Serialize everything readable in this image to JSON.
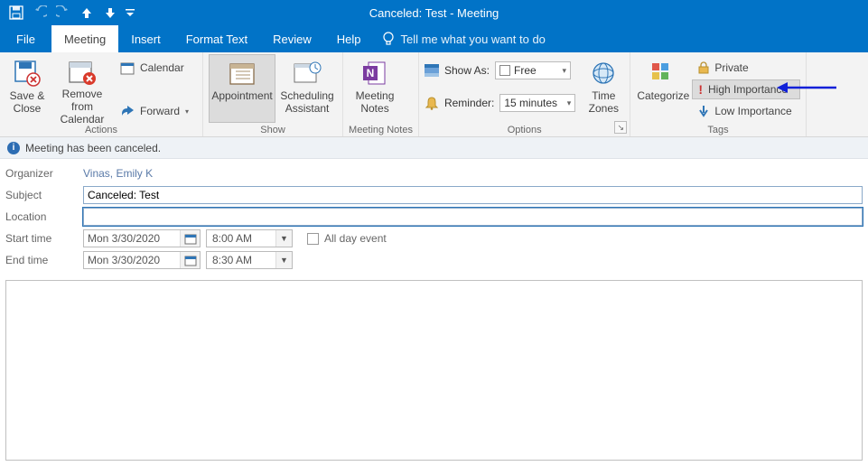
{
  "window": {
    "title": "Canceled: Test  -  Meeting"
  },
  "tabs": {
    "file": "File",
    "meeting": "Meeting",
    "insert": "Insert",
    "format": "Format Text",
    "review": "Review",
    "help": "Help",
    "tellme": "Tell me what you want to do"
  },
  "ribbon": {
    "actions": {
      "save_close": "Save & Close",
      "remove_calendar": "Remove from Calendar",
      "calendar": "Calendar",
      "forward": "Forward",
      "caption": "Actions"
    },
    "show": {
      "appointment": "Appointment",
      "scheduling": "Scheduling Assistant",
      "caption": "Show"
    },
    "notes": {
      "meeting_notes": "Meeting Notes",
      "caption": "Meeting Notes"
    },
    "options": {
      "show_as_label": "Show As:",
      "show_as_value": "Free",
      "reminder_label": "Reminder:",
      "reminder_value": "15 minutes",
      "time_zones": "Time Zones",
      "caption": "Options"
    },
    "tags": {
      "categorize": "Categorize",
      "private": "Private",
      "high": "High Importance",
      "low": "Low Importance",
      "caption": "Tags"
    }
  },
  "infobar": {
    "text": "Meeting has been canceled."
  },
  "form": {
    "organizer_label": "Organizer",
    "organizer_value": "Vinas, Emily K",
    "subject_label": "Subject",
    "subject_value": "Canceled: Test",
    "location_label": "Location",
    "location_value": "",
    "start_label": "Start time",
    "start_date": "Mon 3/30/2020",
    "start_time": "8:00 AM",
    "end_label": "End time",
    "end_date": "Mon 3/30/2020",
    "end_time": "8:30 AM",
    "allday": "All day event"
  }
}
